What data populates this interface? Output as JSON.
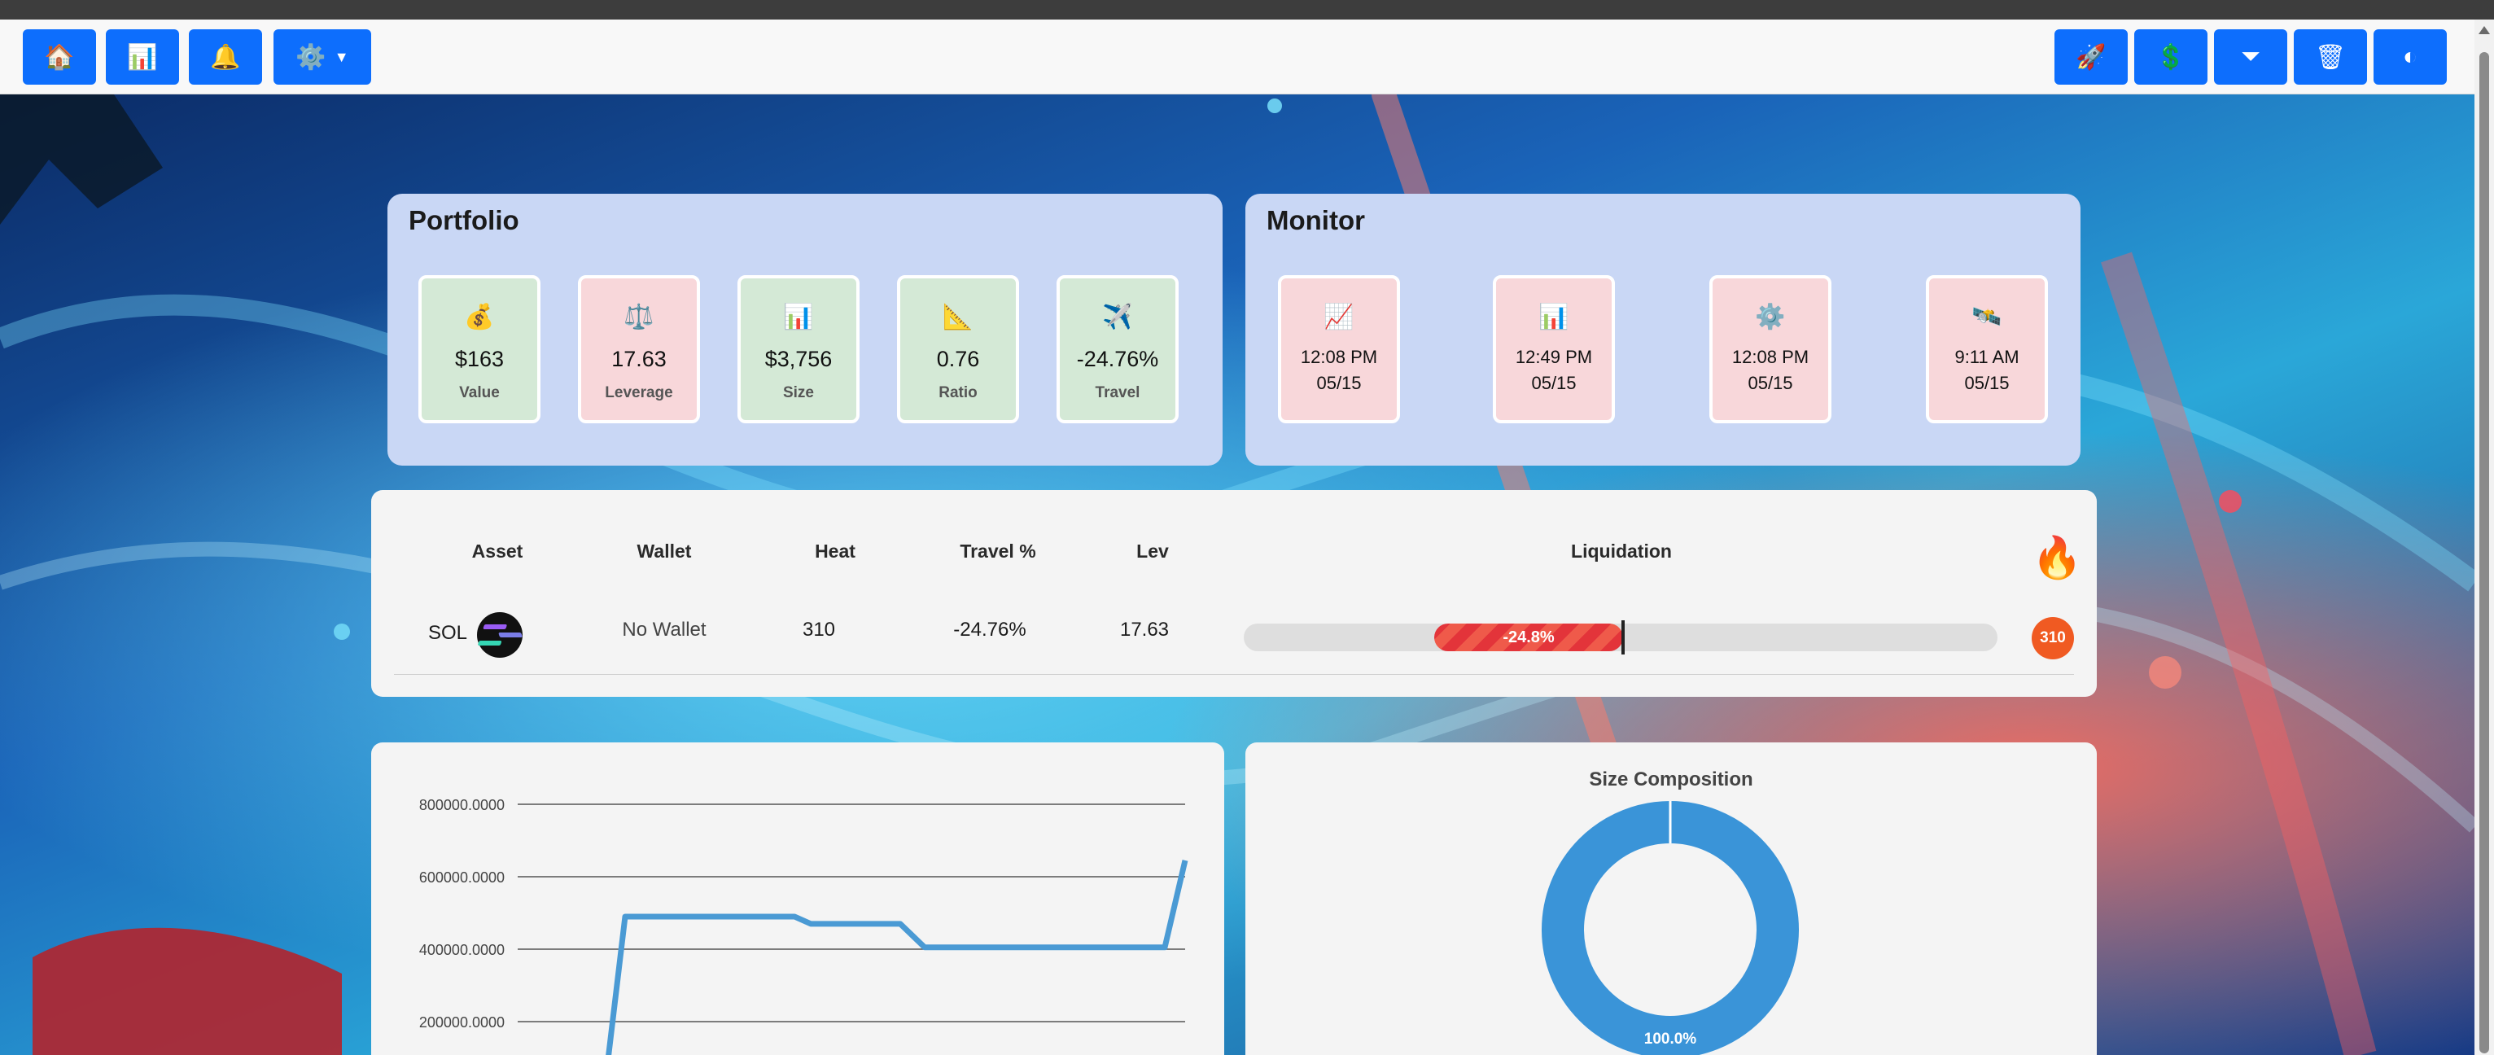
{
  "navbar": {
    "left_buttons": [
      {
        "name": "home-icon",
        "glyph": "🏠"
      },
      {
        "name": "bar-chart-icon",
        "glyph": "📊"
      },
      {
        "name": "bell-icon",
        "glyph": "🔔"
      },
      {
        "name": "gear-icon",
        "glyph": "⚙️"
      }
    ],
    "right_buttons": [
      {
        "name": "rocket-icon",
        "glyph": "🚀"
      },
      {
        "name": "dollar-icon",
        "glyph": "💲"
      },
      {
        "name": "funnel-icon",
        "glyph": "⏷"
      },
      {
        "name": "trash-icon",
        "glyph": "🗑"
      },
      {
        "name": "palette-icon",
        "glyph": "◐"
      }
    ],
    "button_color": "#0d6efd"
  },
  "portfolio": {
    "title": "Portfolio",
    "tiles": [
      {
        "icon": "money-bag-icon",
        "glyph": "💰",
        "value": "$163",
        "label": "Value"
      },
      {
        "icon": "scale-icon",
        "glyph": "⚖️",
        "value": "17.63",
        "label": "Leverage"
      },
      {
        "icon": "bar-chart-icon",
        "glyph": "📊",
        "value": "$3,756",
        "label": "Size"
      },
      {
        "icon": "ruler-icon",
        "glyph": "📐",
        "value": "0.76",
        "label": "Ratio"
      },
      {
        "icon": "airplane-icon",
        "glyph": "✈️",
        "value": "-24.76%",
        "label": "Travel"
      }
    ]
  },
  "monitor": {
    "title": "Monitor",
    "tiles": [
      {
        "icon": "chart-up-icon",
        "glyph": "📈",
        "time": "12:08 PM",
        "date": "05/15"
      },
      {
        "icon": "bar-chart-icon",
        "glyph": "📊",
        "time": "12:49 PM",
        "date": "05/15"
      },
      {
        "icon": "gear-icon",
        "glyph": "⚙️",
        "time": "12:08 PM",
        "date": "05/15"
      },
      {
        "icon": "satellite-icon",
        "glyph": "🛰️",
        "time": "9:11 AM",
        "date": "05/15"
      }
    ]
  },
  "positions": {
    "headers": {
      "asset": "Asset",
      "wallet": "Wallet",
      "heat": "Heat",
      "travel": "Travel %",
      "lev": "Lev",
      "liquidation": "Liquidation"
    },
    "row": {
      "asset": "SOL",
      "wallet": "No Wallet",
      "heat": "310",
      "travel": "-24.76%",
      "lev": "17.63",
      "liquidation_label": "-24.8%",
      "liquidation_percent": -24.8,
      "heat_badge": "310"
    },
    "header_icon": {
      "name": "fire-icon",
      "glyph": "🔥"
    }
  },
  "chart_data": [
    {
      "type": "line",
      "title": "",
      "xlabel": "",
      "ylabel": "",
      "yticks": [
        "800000.0000",
        "600000.0000",
        "400000.0000",
        "200000.0000"
      ],
      "ylim": [
        0,
        850000
      ],
      "series": [
        {
          "color": "#4a9ad4",
          "x": [
            0,
            1,
            2,
            3,
            4,
            5,
            6,
            7,
            8,
            9,
            10,
            11,
            12,
            13
          ],
          "y": [
            0,
            490000,
            490000,
            490000,
            490000,
            470000,
            470000,
            405000,
            405000,
            405000,
            405000,
            405000,
            405000,
            645000
          ]
        }
      ]
    },
    {
      "type": "pie",
      "title": "Size Composition",
      "slices": [
        {
          "label": "100.0%",
          "value": 100,
          "color": "#3a94d8"
        }
      ]
    }
  ]
}
